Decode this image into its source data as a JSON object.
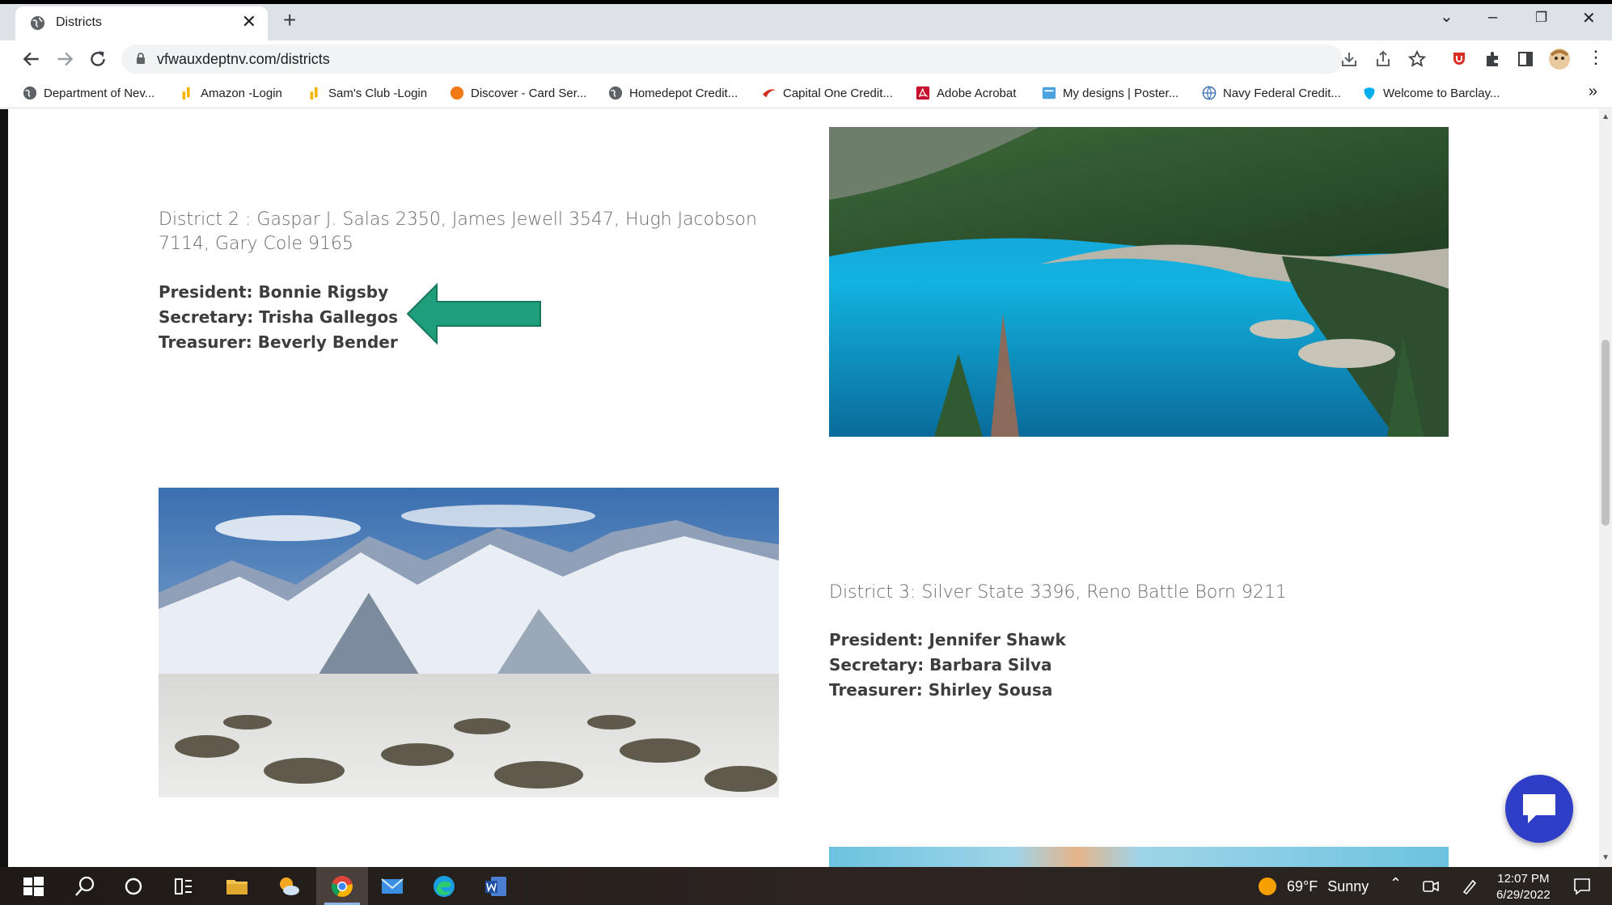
{
  "browser": {
    "tab_title": "Districts",
    "url": "vfwauxdeptnv.com/districts",
    "bookmarks": [
      {
        "label": "Department of Nev...",
        "icon": "globe-icon"
      },
      {
        "label": "Amazon -Login",
        "icon": "amazon-bar-icon"
      },
      {
        "label": "Sam's Club -Login",
        "icon": "samsclub-bar-icon"
      },
      {
        "label": "Discover - Card Ser...",
        "icon": "discover-icon"
      },
      {
        "label": "Homedepot Credit...",
        "icon": "globe-icon"
      },
      {
        "label": "Capital One Credit...",
        "icon": "capital-one-icon"
      },
      {
        "label": "Adobe Acrobat",
        "icon": "acrobat-icon"
      },
      {
        "label": "My designs | Poster...",
        "icon": "postermywall-icon"
      },
      {
        "label": "Navy Federal Credit...",
        "icon": "globe-icon"
      },
      {
        "label": "Welcome to Barclay...",
        "icon": "barclays-icon"
      }
    ]
  },
  "districts": [
    {
      "heading": "District 2 : Gaspar J. Salas 2350, James Jewell 3547, Hugh Jacobson 7114, Gary Cole 9165",
      "president": "President: Bonnie Rigsby",
      "secretary": "Secretary: Trisha Gallegos",
      "treasurer": "Treasurer: Beverly Bender",
      "photo": "lake-tahoe-photo"
    },
    {
      "heading": "District 3: Silver State 3396, Reno Battle Born 9211",
      "president": "President: Jennifer Shawk",
      "secretary": "Secretary: Barbara Silva",
      "treasurer": "Treasurer: Shirley Sousa",
      "photo": "snowy-mountains-photo"
    }
  ],
  "annotation": {
    "color": "#1e9e7a",
    "icon": "arrow-left-icon"
  },
  "chat": {
    "color": "#2f3ec6",
    "icon": "chat-bubble-icon"
  },
  "taskbar": {
    "weather_temp": "69°F",
    "weather_desc": "Sunny",
    "time": "12:07 PM",
    "date": "6/29/2022"
  }
}
